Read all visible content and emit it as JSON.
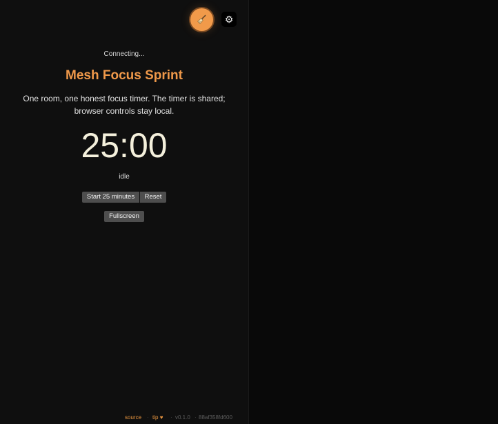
{
  "header": {
    "avatar_icon": "broom-icon",
    "avatar_color": "#f19a4a",
    "settings_icon": "gear-icon",
    "settings_glyph": "⚙"
  },
  "main": {
    "status": "Connecting...",
    "title": "Mesh Focus Sprint",
    "description": "One room, one honest focus timer. The timer is shared; browser controls stay local.",
    "timer": "25:00",
    "state": "idle",
    "accent_color": "#f0994a"
  },
  "controls": {
    "start_label": "Start 25 minutes",
    "reset_label": "Reset",
    "fullscreen_label": "Fullscreen"
  },
  "footer": {
    "source_label": "source",
    "tip_label": "tip",
    "heart": "♥",
    "separator": "·",
    "version": "v0.1.0",
    "commit": "88af358fd600"
  }
}
